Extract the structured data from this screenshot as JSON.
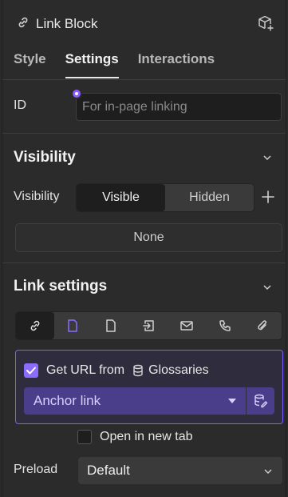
{
  "header": {
    "title": "Link Block",
    "icons": [
      "link-icon",
      "add-cube-icon"
    ]
  },
  "tabs": [
    {
      "label": "Style",
      "active": false
    },
    {
      "label": "Settings",
      "active": true
    },
    {
      "label": "Interactions",
      "active": false
    }
  ],
  "id_field": {
    "label": "ID",
    "placeholder": "For in-page linking",
    "value": ""
  },
  "visibility": {
    "section_title": "Visibility",
    "row_label": "Visibility",
    "options": [
      "Visible",
      "Hidden"
    ],
    "selected": "Visible",
    "conditions_button": "None"
  },
  "link_settings": {
    "section_title": "Link settings",
    "types": [
      "url-link-icon",
      "page-icon",
      "page-outline-icon",
      "section-link-icon",
      "email-icon",
      "phone-icon",
      "file-attachment-icon"
    ],
    "selected_type_index": 0,
    "glossary": {
      "checkbox_label": "Get URL from",
      "source_label": "Glossaries",
      "checked": true,
      "select_value": "Anchor link"
    },
    "new_tab": {
      "label": "Open in new tab",
      "checked": false
    }
  },
  "preload": {
    "label": "Preload",
    "value": "Default"
  },
  "colors": {
    "accent": "#8c6cff",
    "panel": "#2b2b2b",
    "select_bg": "#4a3d8a"
  }
}
